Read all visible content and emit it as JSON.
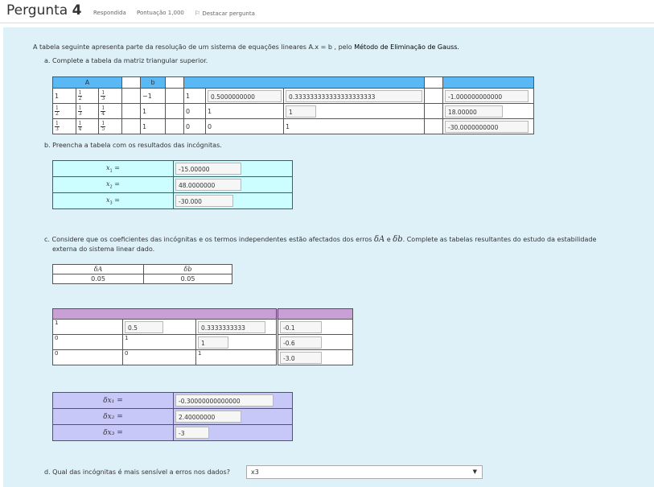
{
  "header": {
    "question_word": "Pergunta",
    "question_number": "4",
    "status": "Respondida",
    "score": "Pontuação 1,000",
    "flag_label": "Destacar pergunta"
  },
  "intro": {
    "text_before": "A tabela seguinte apresenta parte da resolução de um sistema de equações lineares A.x = b , pelo ",
    "method": "Método de Eliminação de Gauss."
  },
  "part_a": {
    "label": "a. Complete a tabela da matriz triangular superior.",
    "head_A": "A",
    "head_b": "b",
    "row1": {
      "fracs": [
        [
          "1",
          "2"
        ],
        [
          "1",
          "3"
        ]
      ],
      "first": "1",
      "b": "−1",
      "u1": "1",
      "u2": "0.5000000000",
      "u3": "0.333333333333333333333",
      "rhs": "-1.000000000000"
    },
    "row2": {
      "fracs": [
        [
          "1",
          "2"
        ],
        [
          "1",
          "3"
        ],
        [
          "1",
          "4"
        ]
      ],
      "b": "1",
      "u1": "0",
      "u2": "1",
      "u3": "1",
      "rhs": "18.00000"
    },
    "row3": {
      "fracs": [
        [
          "1",
          "3"
        ],
        [
          "1",
          "4"
        ],
        [
          "1",
          "5"
        ]
      ],
      "b": "1",
      "u1": "0",
      "u2": "0",
      "u3": "1",
      "rhs": "-30.0000000000"
    }
  },
  "part_b": {
    "label": "b. Preencha a tabela com os resultados das incógnitas.",
    "rows": [
      {
        "var": "x",
        "sub": "1",
        "value": "-15.00000"
      },
      {
        "var": "x",
        "sub": "2",
        "value": "48.0000000"
      },
      {
        "var": "x",
        "sub": "3",
        "value": "-30.000"
      }
    ]
  },
  "part_c": {
    "label_before": "c. Considere que os coeficientes das incógnitas e os termos independentes estão afectados dos erros ",
    "err_A": "δA",
    "conj": " e ",
    "err_b": "δb",
    "label_after": ". Complete as tabelas resultantes do estudo da estabilidade",
    "label_line2": "externa do sistema linear dado.",
    "err_table": {
      "h1": "δA",
      "h2": "δb",
      "v1": "0.05",
      "v2": "0.05"
    },
    "matrix": [
      {
        "c1": "1",
        "c2": "0.5",
        "c3": "0.3333333333",
        "rhs": "-0.1"
      },
      {
        "c1": "0",
        "c2": "1",
        "c3": "1",
        "rhs": "-0.6"
      },
      {
        "c1": "0",
        "c2": "0",
        "c3": "1",
        "rhs": "-3.0"
      }
    ],
    "deltas": [
      {
        "label": "δx₁ =",
        "value": "-0.30000000000000"
      },
      {
        "label": "δx₂ =",
        "value": "2.40000000"
      },
      {
        "label": "δx₃ =",
        "value": "-3"
      }
    ]
  },
  "part_d": {
    "label": "d. Qual das incógnitas é mais sensível a erros nos dados?",
    "selected": "x3",
    "arrow": "▼"
  },
  "colors": {
    "blue_head": "#5ab8f5",
    "purple_head": "#c9a0d6",
    "cyan_cell": "#ccfdff",
    "lavender_cell": "#c8c8f8",
    "content_bg": "#def0f8"
  }
}
